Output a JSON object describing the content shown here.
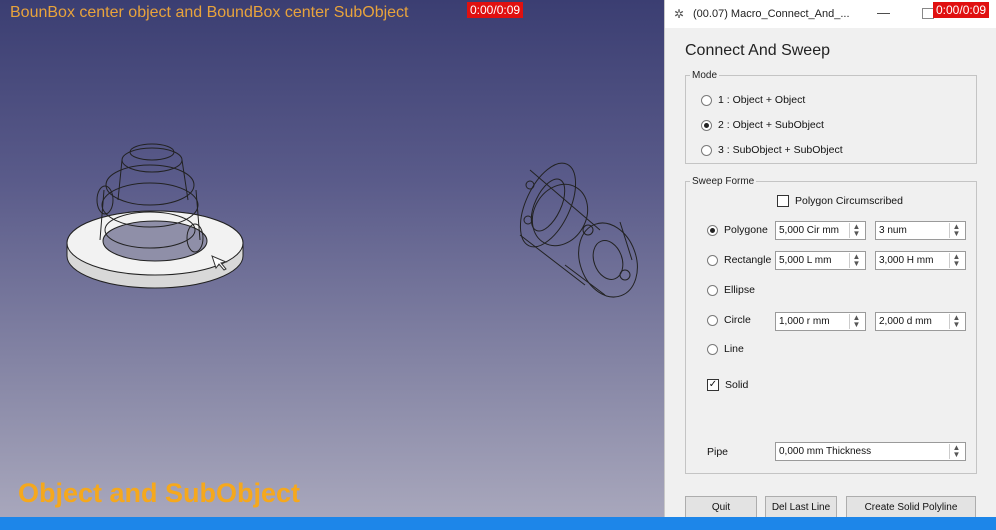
{
  "viewport": {
    "title": "BounBox center object and BoundBox center SubObject",
    "timer": "0:00/0:09",
    "caption": "Object and SubObject"
  },
  "window": {
    "title": "(00.07) Macro_Connect_And_...",
    "minimize": "—",
    "timer": "0:00/0:09"
  },
  "panel": {
    "heading": "Connect And Sweep",
    "mode": {
      "legend": "Mode",
      "options": [
        {
          "label": "1 : Object + Object",
          "checked": false
        },
        {
          "label": "2 : Object + SubObject",
          "checked": true
        },
        {
          "label": "3 : SubObject + SubObject",
          "checked": false
        }
      ]
    },
    "sweep": {
      "legend": "Sweep Forme",
      "polygon_circumscribed": "Polygon Circumscribed",
      "shapes": [
        {
          "label": "Polygone",
          "checked": true,
          "value1": "5,000 Cir mm",
          "value2": "3 num"
        },
        {
          "label": "Rectangle",
          "checked": false,
          "value1": "5,000 L mm",
          "value2": "3,000 H mm"
        },
        {
          "label": "Ellipse",
          "checked": false
        },
        {
          "label": "Circle",
          "checked": false,
          "value1": "1,000 r mm",
          "value2": "2,000 d mm"
        },
        {
          "label": "Line",
          "checked": false
        }
      ],
      "solid": {
        "label": "Solid",
        "checked": true,
        "mark": "✓"
      },
      "pipe": {
        "label": "Pipe",
        "value": "0,000 mm Thickness"
      }
    },
    "buttons": {
      "quit": "Quit",
      "del_last_line": "Del Last Line",
      "create": "Create Solid Polyline"
    }
  },
  "icons": {
    "window": "gear-icon",
    "spin_up": "▲",
    "spin_down": "▼"
  },
  "colors": {
    "viewport_title": "#e8a33c",
    "caption": "#f5a81d",
    "timer_bg": "#e01010",
    "taskbar": "#1d86e9"
  }
}
